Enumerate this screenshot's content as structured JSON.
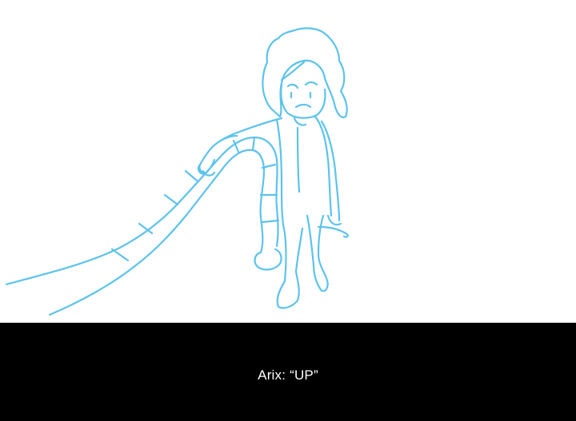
{
  "scene": {
    "background_color": "#ffffff",
    "sketch_color": "#5cc3ec",
    "figure": "sketch-character-icon"
  },
  "subtitle": {
    "text": "Arix: “UP”",
    "bar_color": "#000000",
    "text_color": "#ffffff"
  }
}
